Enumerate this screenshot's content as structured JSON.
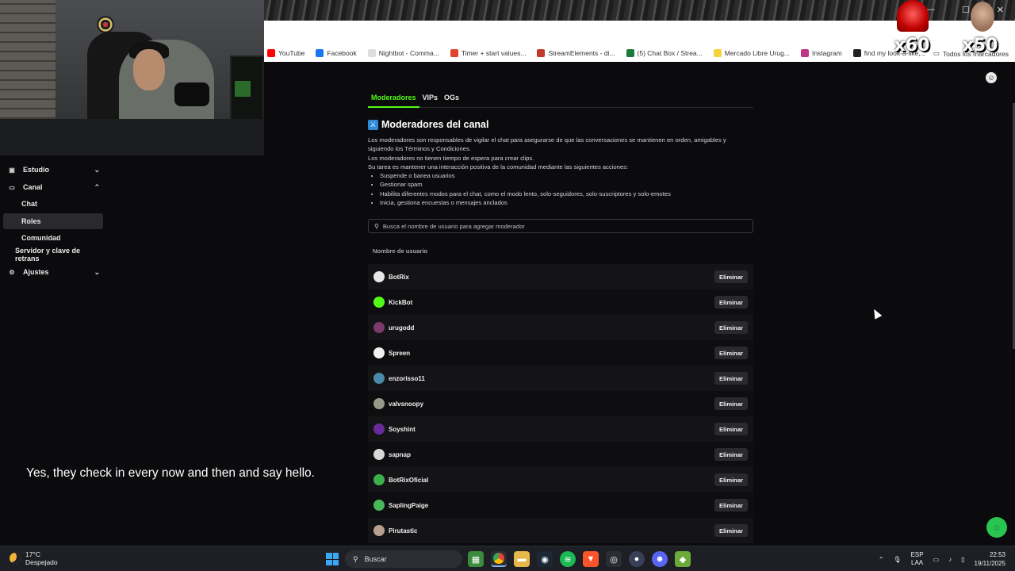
{
  "browser": {
    "bookmarks": [
      {
        "label": "YouTube",
        "color": "#ff0000"
      },
      {
        "label": "Facebook",
        "color": "#1877f2"
      },
      {
        "label": "Nightbot - Comma...",
        "color": "#dddddd"
      },
      {
        "label": "Timer + start values...",
        "color": "#e0452a"
      },
      {
        "label": "StreamElements - di...",
        "color": "#c0392b"
      },
      {
        "label": "(5) Chat Box / Strea...",
        "color": "#1a7a3a"
      },
      {
        "label": "Mercado Libre Urug...",
        "color": "#f5d33a"
      },
      {
        "label": "Instagram",
        "color": "#c13584"
      },
      {
        "label": "find my look-a-like,...",
        "color": "#222222"
      }
    ],
    "all_bookmarks": "Todos los marcadores",
    "overlay": {
      "badge_left": "x60",
      "badge_right": "x50"
    },
    "window_controls": [
      "—",
      "☐",
      "✕"
    ]
  },
  "sidebar": {
    "items": [
      {
        "label": "Estudio",
        "icon": "chevron-down-icon",
        "chevron": "⌄"
      },
      {
        "label": "Canal",
        "icon": "chevron-up-icon",
        "chevron": "⌃"
      },
      {
        "label": "Chat"
      },
      {
        "label": "Roles"
      },
      {
        "label": "Comunidad"
      },
      {
        "label": "Servidor y clave de retrans"
      },
      {
        "label": "Ajustes",
        "chevron": "⌄"
      }
    ]
  },
  "subtitle": "Yes, they check in every now and then and say hello.",
  "main": {
    "tabs": [
      {
        "label": "Moderadores",
        "active": true
      },
      {
        "label": "VIPs"
      },
      {
        "label": "OGs"
      }
    ],
    "title": "Moderadores del canal",
    "description": {
      "p1": "Los moderadores son responsables de vigilar el chat para asegurarse de que las conversaciones se mantienen en orden, amigables y siguiendo los Términos y Condiciones.",
      "p2": "Los moderadores no tienen tiempo de espera para crear clips.",
      "p3": "Su tarea es mantener una interacción positiva de la comunidad mediante las siguientes acciones:",
      "bullets": [
        "Suspende o banea usuarios",
        "Gestionar spam",
        "Habilita diferentes modos para el chat, como el modo lento, solo-seguidores, solo-suscriptores y solo-emotes",
        "Inicia, gestiona encuestas o mensajes anclados"
      ]
    },
    "search_placeholder": "Busca el nombre de usuario para agregar moderador",
    "column_header": "Nombre de usuario",
    "remove_label": "Eliminar",
    "moderators": [
      {
        "name": "BotRix",
        "avatar_color": "#e8e8e8"
      },
      {
        "name": "KickBot",
        "avatar_color": "#53fc18"
      },
      {
        "name": "urugodd",
        "avatar_color": "#7a3a6a"
      },
      {
        "name": "Spreen",
        "avatar_color": "#f2f2f2"
      },
      {
        "name": "enzorisso11",
        "avatar_color": "#4a8aa8"
      },
      {
        "name": "valvsnoopy",
        "avatar_color": "#9a9a8a"
      },
      {
        "name": "Soyshint",
        "avatar_color": "#6a2a9a"
      },
      {
        "name": "sapnap",
        "avatar_color": "#d8d8d8"
      },
      {
        "name": "BotRixOficial",
        "avatar_color": "#3ab04a"
      },
      {
        "name": "SaplingPaige",
        "avatar_color": "#4ab85a"
      },
      {
        "name": "Pirutastic",
        "avatar_color": "#b8a090"
      }
    ]
  },
  "taskbar": {
    "weather_temp": "17°C",
    "weather_desc": "Despejado",
    "search_label": "Buscar",
    "lang_line1": "ESP",
    "lang_line2": "LAA",
    "time": "22:53",
    "date": "19/11/2025"
  }
}
